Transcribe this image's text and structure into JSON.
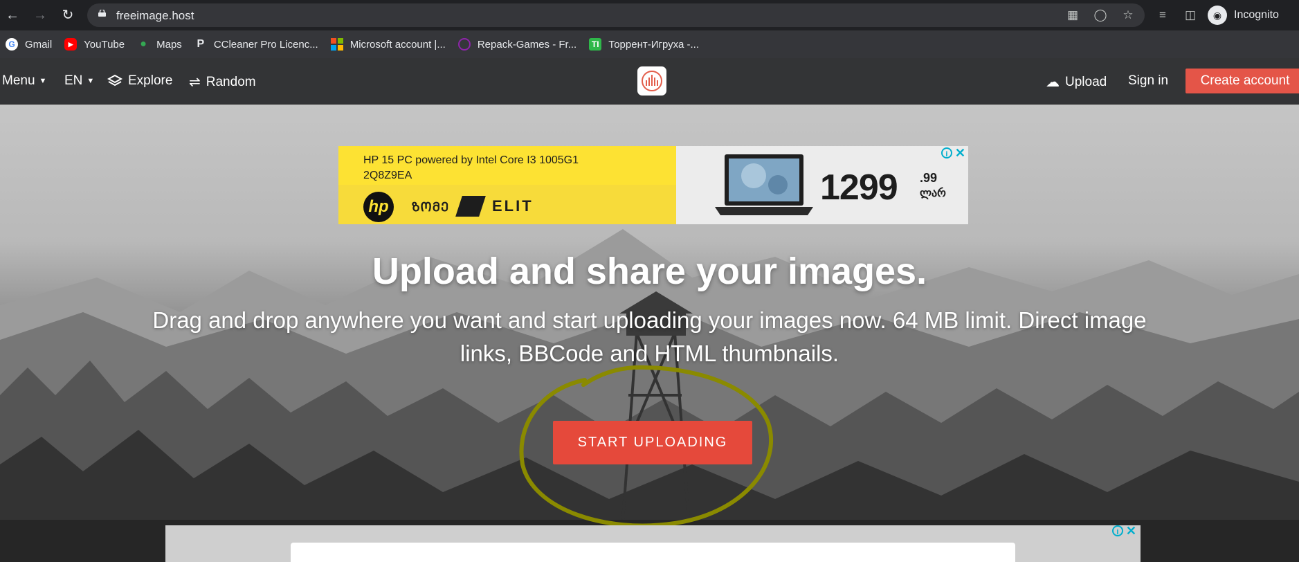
{
  "browser": {
    "url": "freeimage.host",
    "profile_label": "Incognito",
    "nav": {
      "back": "back-arrow-icon",
      "forward": "forward-arrow-icon",
      "reload": "reload-icon"
    }
  },
  "bookmarks": [
    {
      "label": "Gmail",
      "icon": "google-icon",
      "color": "#ffffff"
    },
    {
      "label": "YouTube",
      "icon": "youtube-icon",
      "color": "#ff0000"
    },
    {
      "label": "Maps",
      "icon": "maps-icon",
      "color": "#34a853"
    },
    {
      "label": "CCleaner Pro Licenc...",
      "icon": "pinterest-icon",
      "color": "#35363a"
    },
    {
      "label": "Microsoft account |...",
      "icon": "microsoft-icon",
      "color": "#f25022"
    },
    {
      "label": "Repack-Games - Fr...",
      "icon": "repack-icon",
      "color": "#8e24aa"
    },
    {
      "label": "Торрент-Игруха -...",
      "icon": "torrent-icon",
      "color": "#2fb84a"
    }
  ],
  "site_header": {
    "menu": "Menu",
    "language": "EN",
    "explore": "Explore",
    "random": "Random",
    "upload": "Upload",
    "sign_in": "Sign in",
    "create_account": "Create account"
  },
  "ad_top": {
    "product_line1": "HP 15 PC powered by Intel Core I3 1005G1",
    "product_line2": "2Q8Z9EA",
    "brand_hp": "hp",
    "brand_zoomer": "ᲖᲝᲛᲔ",
    "brand_elit": "ELIT",
    "price_main": "1299",
    "price_decimals": ".99",
    "price_currency": "ლარ"
  },
  "hero": {
    "title": "Upload and share your images.",
    "subtitle": "Drag and drop anywhere you want and start uploading your images now. 64 MB limit. Direct image links, BBCode and HTML thumbnails.",
    "start_button": "START UPLOADING"
  },
  "colors": {
    "accent": "#e5493b",
    "header_bg": "#333436",
    "ad_yellow": "#fde233",
    "annotation_circle": "#8a8a00"
  }
}
